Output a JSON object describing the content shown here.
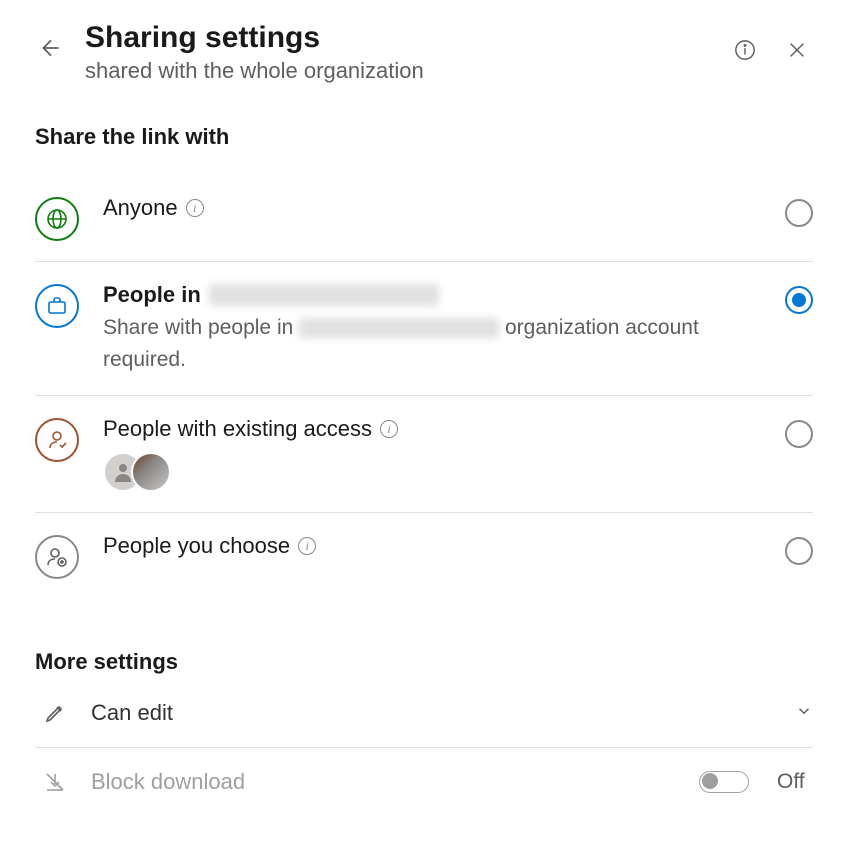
{
  "header": {
    "title": "Sharing settings",
    "subtitle": "shared with the whole organization"
  },
  "share_section": {
    "heading": "Share the link with",
    "options": [
      {
        "id": "anyone",
        "title": "Anyone",
        "has_info": true,
        "selected": false,
        "icon_color": "#107c10"
      },
      {
        "id": "people-in-org",
        "title_prefix": "People in",
        "desc_prefix": "Share with people in",
        "desc_suffix": "organization account required.",
        "selected": true,
        "icon_color": "#0078d4"
      },
      {
        "id": "existing-access",
        "title": "People with existing access",
        "has_info": true,
        "selected": false,
        "icon_color": "#a0522d",
        "avatars": 2
      },
      {
        "id": "people-you-choose",
        "title": "People you choose",
        "has_info": true,
        "selected": false,
        "icon_color": "#605e5c"
      }
    ]
  },
  "more_settings": {
    "heading": "More settings",
    "permission": {
      "label": "Can edit",
      "icon": "pencil"
    },
    "block_download": {
      "label": "Block download",
      "state_label": "Off",
      "enabled": false
    }
  }
}
